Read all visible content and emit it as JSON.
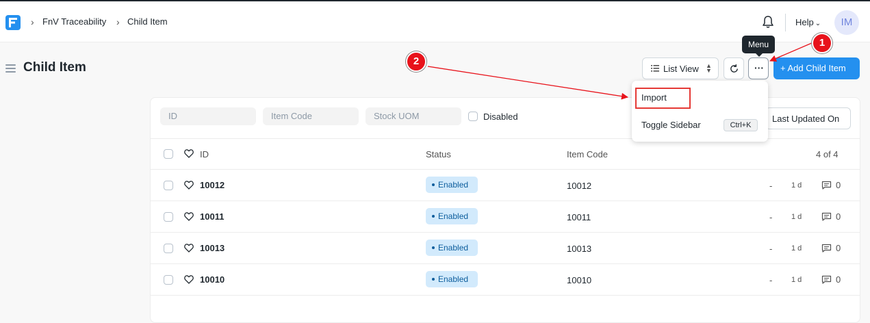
{
  "navbar": {
    "breadcrumb": [
      "FnV Traceability",
      "Child Item"
    ],
    "help_label": "Help",
    "avatar_initials": "IM"
  },
  "page": {
    "title": "Child Item"
  },
  "toolbar": {
    "list_view_label": "List View",
    "menu_tooltip": "Menu",
    "add_label": "+ Add Child Item"
  },
  "menu": {
    "items": [
      {
        "label": "Import"
      },
      {
        "label": "Toggle Sidebar",
        "shortcut": "Ctrl+K"
      }
    ]
  },
  "filters": {
    "id_placeholder": "ID",
    "item_code_placeholder": "Item Code",
    "stock_uom_placeholder": "Stock UOM",
    "disabled_label": "Disabled",
    "sort_label": "Last Updated On"
  },
  "table": {
    "headers": {
      "id": "ID",
      "status": "Status",
      "item_code": "Item Code",
      "count": "4 of 4"
    },
    "rows": [
      {
        "id": "10012",
        "status": "Enabled",
        "item_code": "10012",
        "dash": "-",
        "age": "1 d",
        "comments": "0"
      },
      {
        "id": "10011",
        "status": "Enabled",
        "item_code": "10011",
        "dash": "-",
        "age": "1 d",
        "comments": "0"
      },
      {
        "id": "10013",
        "status": "Enabled",
        "item_code": "10013",
        "dash": "-",
        "age": "1 d",
        "comments": "0"
      },
      {
        "id": "10010",
        "status": "Enabled",
        "item_code": "10010",
        "dash": "-",
        "age": "1 d",
        "comments": "0"
      }
    ]
  },
  "annotations": {
    "marker_1": "1",
    "marker_2": "2",
    "color": "#e8131b"
  },
  "colors": {
    "accent": "#2490ef",
    "status_pill_bg": "#d2eafc",
    "status_pill_text": "#0c5d9c"
  }
}
